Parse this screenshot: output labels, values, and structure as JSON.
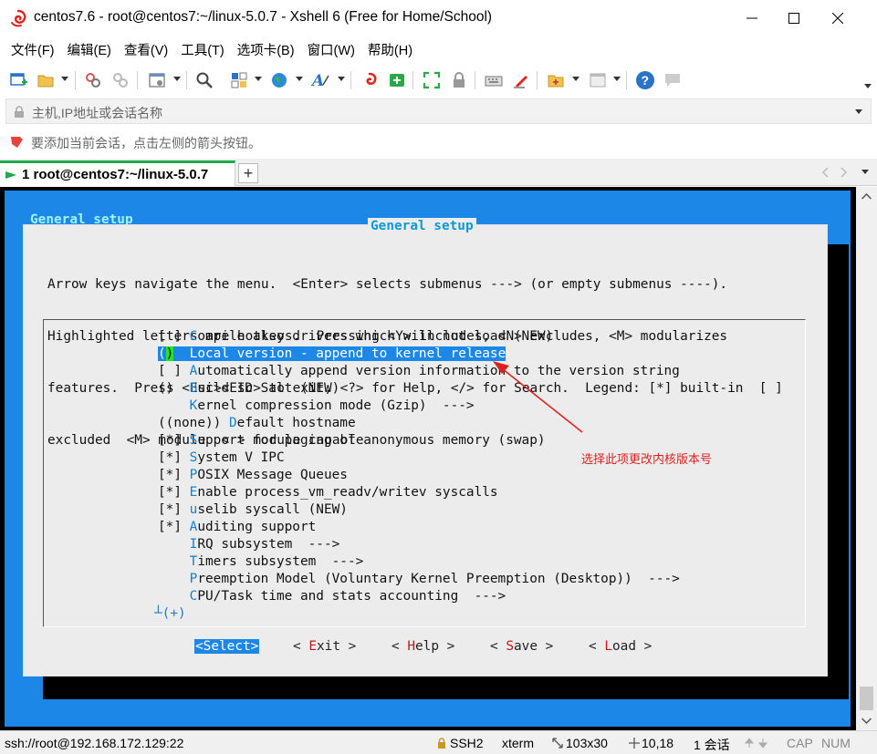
{
  "window": {
    "title": "centos7.6 - root@centos7:~/linux-5.0.7 - Xshell 6 (Free for Home/School)",
    "app_icon": "xshell-red-swirl-icon"
  },
  "menubar": [
    "文件(F)",
    "编辑(E)",
    "查看(V)",
    "工具(T)",
    "选项卡(B)",
    "窗口(W)",
    "帮助(H)"
  ],
  "address": {
    "placeholder": "主机,IP地址或会话名称"
  },
  "hint": {
    "text": "要添加当前会话，点击左侧的箭头按钮。"
  },
  "tab": {
    "label": "1 root@centos7:~/linux-5.0.7",
    "add_label": "+"
  },
  "terminal": {
    "header_title": "General setup",
    "dialog_title": "General setup",
    "help_lines": [
      "Arrow keys navigate the menu.  <Enter> selects submenus ---> (or empty submenus ----).",
      "Highlighted letters are hotkeys.  Pressing <Y> includes, <N> excludes, <M> modularizes",
      "features.  Press <Esc><Esc> to exit, <?> for Help, </> for Search.  Legend: [*] built-in  [ ]",
      "excluded  <M> module  < > module capable"
    ],
    "options": [
      {
        "prefix": "[ ] ",
        "hotkey": "C",
        "rest": "ompile also drivers which will not load (NEW)"
      },
      {
        "prefix": "()  ",
        "hotkey": "L",
        "rest": "ocal version - append to kernel release",
        "selected": true
      },
      {
        "prefix": "[ ] ",
        "hotkey": "A",
        "rest": "utomatically append version information to the version string"
      },
      {
        "prefix": "()  ",
        "hotkey": "B",
        "rest": "uild ID Salt (NEW)"
      },
      {
        "prefix": "    ",
        "hotkey": "K",
        "rest": "ernel compression mode (Gzip)  --->"
      },
      {
        "prefix": "((none)) ",
        "hotkey": "D",
        "rest": "efault hostname"
      },
      {
        "prefix": "[*] ",
        "hotkey": "S",
        "rest": "upport for paging of anonymous memory (swap)"
      },
      {
        "prefix": "[*] ",
        "hotkey": "S",
        "rest": "ystem V IPC"
      },
      {
        "prefix": "[*] ",
        "hotkey": "P",
        "rest": "OSIX Message Queues"
      },
      {
        "prefix": "[*] ",
        "hotkey": "E",
        "rest": "nable process_vm_readv/writev syscalls"
      },
      {
        "prefix": "[*] ",
        "hotkey": "u",
        "rest": "selib syscall (NEW)"
      },
      {
        "prefix": "[*] ",
        "hotkey": "A",
        "rest": "uditing support"
      },
      {
        "prefix": "    ",
        "hotkey": "I",
        "rest": "RQ subsystem  --->"
      },
      {
        "prefix": "    ",
        "hotkey": "T",
        "rest": "imers subsystem  --->"
      },
      {
        "prefix": "    ",
        "hotkey": "P",
        "rest": "reemption Model (Voluntary Kernel Preemption (Desktop))  --->"
      },
      {
        "prefix": "    ",
        "hotkey": "C",
        "rest": "PU/Task time and stats accounting  --->"
      }
    ],
    "more_indicator": "┴(+)",
    "buttons": {
      "select": "<Select>",
      "exit": {
        "open": "< ",
        "hotkey": "E",
        "rest": "xit",
        "close": " >"
      },
      "help": {
        "open": "< ",
        "hotkey": "H",
        "rest": "elp",
        "close": " >"
      },
      "save": {
        "open": "< ",
        "hotkey": "S",
        "rest": "ave",
        "close": " >"
      },
      "load": {
        "open": "< ",
        "hotkey": "L",
        "rest": "oad",
        "close": " >"
      }
    },
    "annotation": "选择此项更改内核版本号"
  },
  "statusbar": {
    "connection": "ssh://root@192.168.172.129:22",
    "protocol": "SSH2",
    "term_type": "xterm",
    "size": "103x30",
    "cursor": "10,18",
    "sessions": "1 会话",
    "cap": "CAP",
    "num": "NUM"
  },
  "colors": {
    "terminal_bg": "#1c87e6",
    "dialog_bg": "#ececec",
    "title_cyan": "#0e9ad6",
    "hotkey_blue": "#1480cf",
    "cursor_green": "#20e61b",
    "annotation_red": "#e02020",
    "tab_accent": "#1eaa4a"
  }
}
